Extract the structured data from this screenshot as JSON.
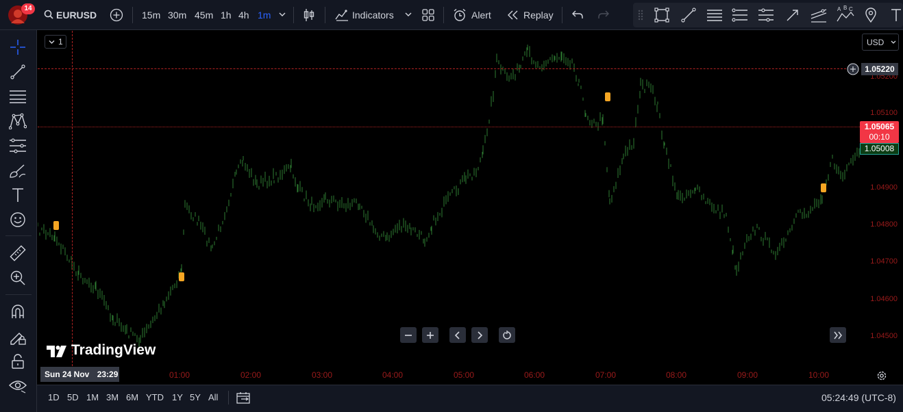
{
  "symbol": {
    "name": "EURUSD",
    "notifications": "14"
  },
  "timeframes": [
    "15m",
    "30m",
    "45m",
    "1h",
    "4h",
    "1m"
  ],
  "active_timeframe": "1m",
  "toolbar": {
    "indicators_label": "Indicators",
    "alert_label": "Alert",
    "replay_label": "Replay"
  },
  "chart": {
    "interval_label": "1",
    "currency": "USD",
    "crosshair_price": "1.05220",
    "crosshair_price_under": "1.05200",
    "last_price": "1.05065",
    "countdown": "00:10",
    "bid_price": "1.05008",
    "price_labels": [
      "1.05100",
      "1.04900",
      "1.04800",
      "1.04700",
      "1.04600",
      "1.04500"
    ],
    "time_labels": [
      "01:00",
      "02:00",
      "03:00",
      "04:00",
      "05:00",
      "06:00",
      "07:00",
      "08:00",
      "09:00",
      "10:00"
    ],
    "crosshair_date": "Sun 24 Nov",
    "crosshair_time": "23:29",
    "watermark": "TradingView",
    "line_color": "#2e7d32",
    "accent_color": "#2962ff",
    "last_price_color": "#f23645"
  },
  "bottom": {
    "ranges": [
      "1D",
      "5D",
      "1M",
      "3M",
      "6M",
      "YTD",
      "1Y",
      "5Y",
      "All"
    ],
    "clock": "05:24:49 (UTC-8)"
  }
}
